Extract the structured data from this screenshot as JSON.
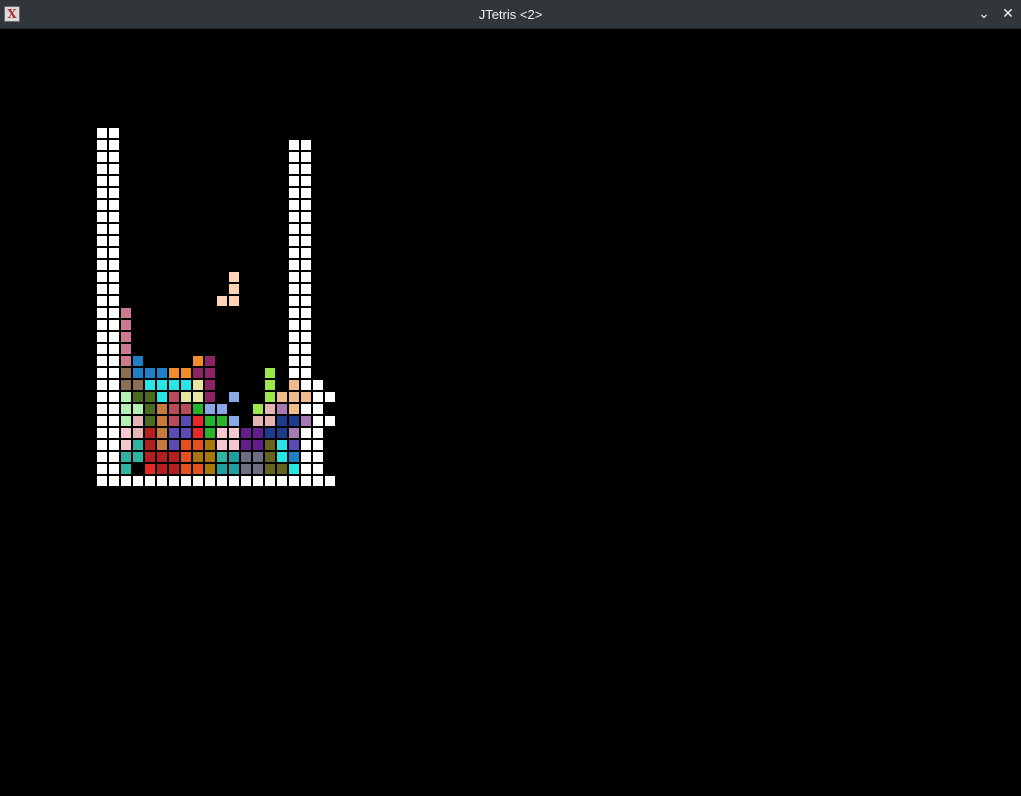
{
  "window": {
    "title": "JTetris <2>",
    "icon": "x-app-icon",
    "minimize_icon": "chevron-down-icon",
    "close_icon": "close-icon"
  },
  "colors": {
    "well": "#ffffff",
    "background": "#000000"
  },
  "board": {
    "columns": 20,
    "rows": 30,
    "cell_colors": {
      "W": "#ffffff",
      "a": "#c97a8e",
      "b": "#1e7fc4",
      "c": "#f28c28",
      "d": "#8a2463",
      "e": "#9ae84a",
      "f": "#8b6f52",
      "g": "#28e6e6",
      "h": "#e6e6a0",
      "i": "#ffd3b4",
      "j": "#f0bc8c",
      "k": "#4a6a1e",
      "l": "#b84a5a",
      "m": "#8aa8e6",
      "n": "#b4f0b4",
      "o": "#c87a3c",
      "p": "#e62828",
      "q": "#28b428",
      "r": "#5a4ab4",
      "s": "#e6b4b4",
      "t": "#1e3a8a",
      "u": "#a878b4",
      "v": "#f5c8d0",
      "w": "#641e8c",
      "x": "#2eb4a0",
      "y": "#b41e1e",
      "z": "#e6501e",
      "A": "#a8780a",
      "B": "#1ea0a0",
      "C": "#6e6e82",
      "D": "#64641e"
    },
    "grid": [
      "WW..................",
      "WW..............WW..",
      "WW..............WW..",
      "WW..............WW..",
      "WW..............WW..",
      "WW..............WW..",
      "WW..............WW..",
      "WW..............WW..",
      "WW..............WW..",
      "WW..............WW..",
      "WW..............WW..",
      "WW..............WW..",
      "WW.........i....WW..",
      "WW.........i....WW..",
      "WW........ii....WW..",
      "WWa.............WW..",
      "WWa.............WW..",
      "WWa.............WW..",
      "WWa.............WW..",
      "WWab....cd......WW..",
      "WWfbbbccdd....e.WW..",
      "WWffgggghd....e.jWW.",
      "WWnkkglhhd.m..ejjjWW",
      "WWnnkollqmm..esujWW.",
      "WWnskolrpqqm.ssttuWW",
      "WWvsyorrpqvvwwttuWW.",
      "WWvxyorzzAvvwwDgrWW.",
      "WWxxyyyzAAxBCCDgbWW.",
      "WWx.pyyzzABBCCDDgWW.",
      "WWWWWWWWWWWWWWWWWWWW"
    ]
  }
}
